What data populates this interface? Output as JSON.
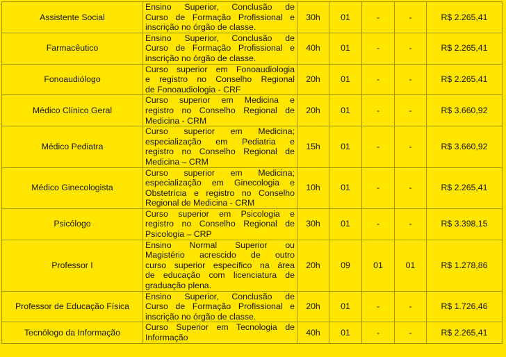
{
  "table": {
    "columns": [
      "cargo",
      "requisitos",
      "carga_horaria",
      "vagas",
      "pcd",
      "negros",
      "vencimento"
    ],
    "rows": [
      {
        "cargo": "Assistente Social",
        "requisitos": "Ensino Superior, Conclusão de Curso de Formação Profissional e inscrição no órgão de classe.",
        "requisitos_lines": [
          "Ensino Superior, Conclusão de",
          "Curso de Formação Profissional e",
          "inscrição no órgão de classe."
        ],
        "carga_horaria": "30h",
        "vagas": "01",
        "pcd": "-",
        "negros": "-",
        "vencimento": "R$ 2.265,41"
      },
      {
        "cargo": "Farmacêutico",
        "requisitos": "Ensino Superior, Conclusão de Curso de Formação Profissional e inscrição no órgão de classe.",
        "requisitos_lines": [
          "Ensino Superior, Conclusão de",
          "Curso de Formação Profissional e",
          "inscrição no órgão de classe."
        ],
        "carga_horaria": "40h",
        "vagas": "01",
        "pcd": "-",
        "negros": "-",
        "vencimento": "R$ 2.265,41"
      },
      {
        "cargo": "Fonoaudiólogo",
        "requisitos": "Curso superior em Fonoaudiologia e registro no Conselho Regional de Fonoaudiologia - CRF",
        "requisitos_lines": [
          "Curso superior em Fonoaudiologia",
          "e registro no Conselho Regional",
          "de Fonoaudiologia - CRF"
        ],
        "carga_horaria": "20h",
        "vagas": "01",
        "pcd": "-",
        "negros": "-",
        "vencimento": "R$ 2.265,41"
      },
      {
        "cargo": "Médico Clínico Geral",
        "requisitos": "Curso superior em Medicina e registro no Conselho Regional de Medicina - CRM",
        "requisitos_lines": [
          "Curso superior em Medicina e",
          "registro no Conselho Regional de",
          "Medicina - CRM"
        ],
        "carga_horaria": "20h",
        "vagas": "01",
        "pcd": "-",
        "negros": "-",
        "vencimento": "R$ 3.660,92"
      },
      {
        "cargo": "Médico Pediatra",
        "requisitos": "Curso superior em Medicina; especialização em Pediatria e registro no Conselho Regional de Medicina – CRM",
        "requisitos_lines": [
          "Curso superior em Medicina;",
          "especialização em Pediatria e",
          "registro no Conselho Regional de",
          "Medicina – CRM"
        ],
        "carga_horaria": "15h",
        "vagas": "01",
        "pcd": "-",
        "negros": "-",
        "vencimento": "R$ 3.660,92"
      },
      {
        "cargo": "Médico Ginecologista",
        "requisitos": "Curso superior em Medicina; especialização em Ginecologia e Obstetrícia e registro no Conselho Regional de Medicina - CRM",
        "requisitos_lines": [
          "Curso superior em Medicina;",
          "especialização em Ginecologia e",
          "Obstetrícia e registro no Conselho",
          "Regional de Medicina - CRM"
        ],
        "carga_horaria": "10h",
        "vagas": "01",
        "pcd": "-",
        "negros": "-",
        "vencimento": "R$ 2.265,41"
      },
      {
        "cargo": "Psicólogo",
        "requisitos": "Curso superior em Psicologia e registro no Conselho Regional de Psicologia – CRP",
        "requisitos_lines": [
          "Curso superior em Psicologia e",
          "registro no Conselho Regional de",
          "Psicologia – CRP"
        ],
        "carga_horaria": "30h",
        "vagas": "01",
        "pcd": "-",
        "negros": "-",
        "vencimento": "R$ 3.398,15"
      },
      {
        "cargo": "Professor I",
        "requisitos": "Ensino Normal Superior ou Magistério acrescido de outro curso superior específico na área de educação com licenciatura de graduação plena.",
        "requisitos_lines": [
          "Ensino Normal Superior ou",
          "Magistério acrescido de outro",
          "curso superior específico na área",
          "de educação com licenciatura de",
          "graduação plena."
        ],
        "carga_horaria": "20h",
        "vagas": "09",
        "pcd": "01",
        "negros": "01",
        "vencimento": "R$ 1.278,86"
      },
      {
        "cargo": "Professor de Educação Física",
        "requisitos": "Ensino Superior, Conclusão de Curso de Formação Profissional e inscrição no órgão de classe.",
        "requisitos_lines": [
          "Ensino Superior, Conclusão de",
          "Curso de Formação Profissional e",
          "inscrição no órgão de classe."
        ],
        "carga_horaria": "20h",
        "vagas": "01",
        "pcd": "-",
        "negros": "-",
        "vencimento": "R$ 1.726,46"
      },
      {
        "cargo": "Tecnólogo da Informação",
        "requisitos": "Curso Superior em Tecnologia de Informação",
        "requisitos_lines": [
          "Curso Superior em Tecnologia de",
          "Informação"
        ],
        "carga_horaria": "40h",
        "vagas": "01",
        "pcd": "-",
        "negros": "-",
        "vencimento": "R$ 2.265,41"
      }
    ]
  },
  "colors": {
    "background": "#FFE500",
    "border": "#9a9200",
    "text": "#161616"
  }
}
